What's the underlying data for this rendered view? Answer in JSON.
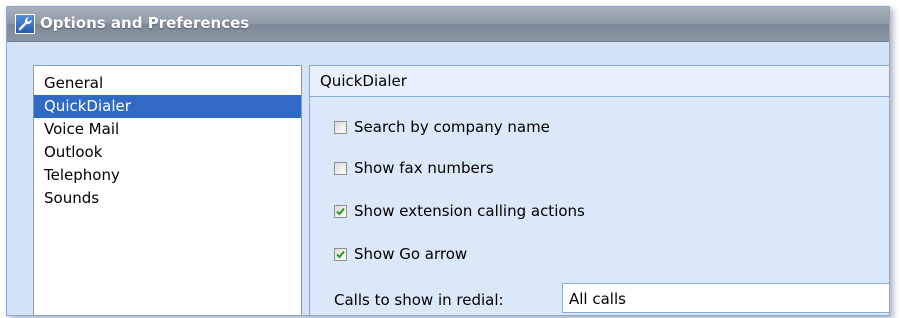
{
  "window": {
    "title": "Options and Preferences",
    "title_icon": "wrench-icon"
  },
  "categories": [
    {
      "label": "General",
      "selected": false
    },
    {
      "label": "QuickDialer",
      "selected": true
    },
    {
      "label": "Voice Mail",
      "selected": false
    },
    {
      "label": "Outlook",
      "selected": false
    },
    {
      "label": "Telephony",
      "selected": false
    },
    {
      "label": "Sounds",
      "selected": false
    }
  ],
  "panel": {
    "header": "QuickDialer",
    "options": [
      {
        "label": "Search by company name",
        "checked": false
      },
      {
        "label": "Show fax numbers",
        "checked": false
      },
      {
        "label": "Show extension calling actions",
        "checked": true
      },
      {
        "label": "Show Go arrow",
        "checked": true
      }
    ],
    "redial": {
      "label": "Calls to show in redial:",
      "value": "All calls"
    }
  },
  "colors": {
    "selection": "#316ac5",
    "panel_background": "#dbe8f9",
    "title_bar": "#8e99a6"
  }
}
